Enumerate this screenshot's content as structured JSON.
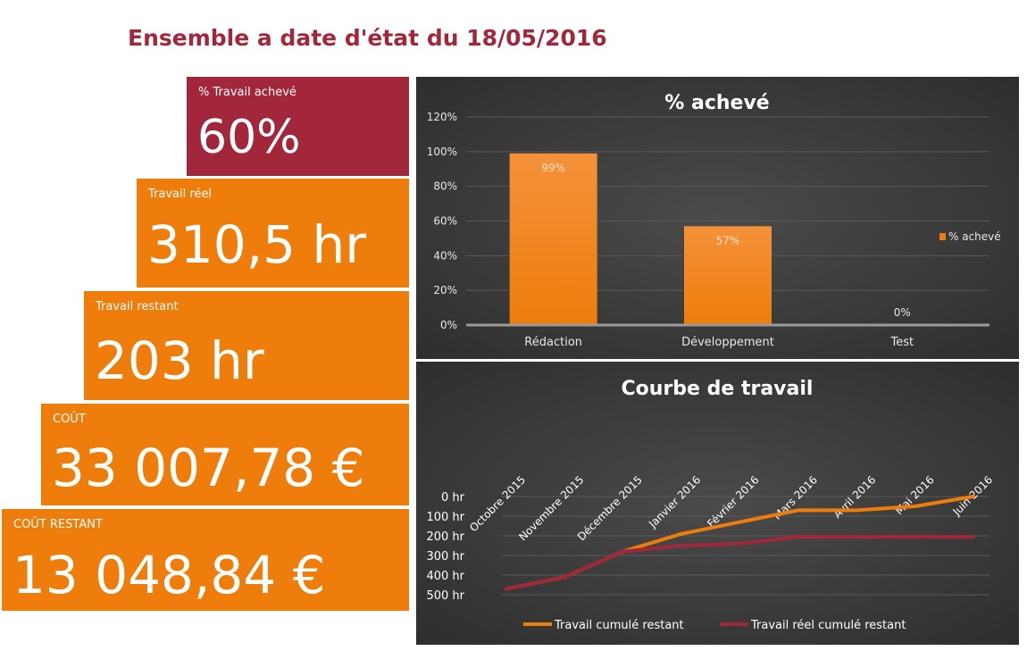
{
  "page_title": "Ensemble a date d'état du 18/05/2016",
  "cards": [
    {
      "label": "% Travail achevé",
      "value": "60%"
    },
    {
      "label": "Travail réel",
      "value": "310,5 hr"
    },
    {
      "label": "Travail restant",
      "value": "203 hr"
    },
    {
      "label": "COÛT",
      "value": "33 007,78 €"
    },
    {
      "label": "COÛT RESTANT",
      "value": "13 048,84 €"
    }
  ],
  "chart_data": [
    {
      "type": "bar",
      "title": "% achevé",
      "categories": [
        "Rédaction",
        "Développement",
        "Test"
      ],
      "series": [
        {
          "name": "% achevé",
          "values": [
            99,
            57,
            0
          ],
          "color": "#ee7d0b"
        }
      ],
      "data_labels": [
        "99%",
        "57%",
        "0%"
      ],
      "ylim": [
        0,
        120
      ],
      "yticks": [
        "0%",
        "20%",
        "40%",
        "60%",
        "80%",
        "100%",
        "120%"
      ],
      "grid": true,
      "legend": "right"
    },
    {
      "type": "line",
      "title": "Courbe de travail",
      "categories": [
        "Octobre 2015",
        "Novembre 2015",
        "Décembre 2015",
        "Janvier 2016",
        "Février 2016",
        "Mars 2016",
        "Avril 2016",
        "Mai 2016",
        "Juin 2016"
      ],
      "series": [
        {
          "name": "Travail cumulé restant",
          "values": [
            470,
            410,
            280,
            190,
            130,
            70,
            70,
            50,
            0
          ],
          "color": "#ee7d0b"
        },
        {
          "name": "Travail réel cumulé restant",
          "values": [
            470,
            410,
            280,
            250,
            240,
            205,
            205,
            205,
            205
          ],
          "color": "#a3273a"
        }
      ],
      "yticks": [
        "0 hr",
        "100 hr",
        "200 hr",
        "300 hr",
        "400 hr",
        "500 hr"
      ],
      "ylim": [
        0,
        500
      ],
      "y_reversed": true,
      "grid": true,
      "legend": "bottom"
    }
  ]
}
